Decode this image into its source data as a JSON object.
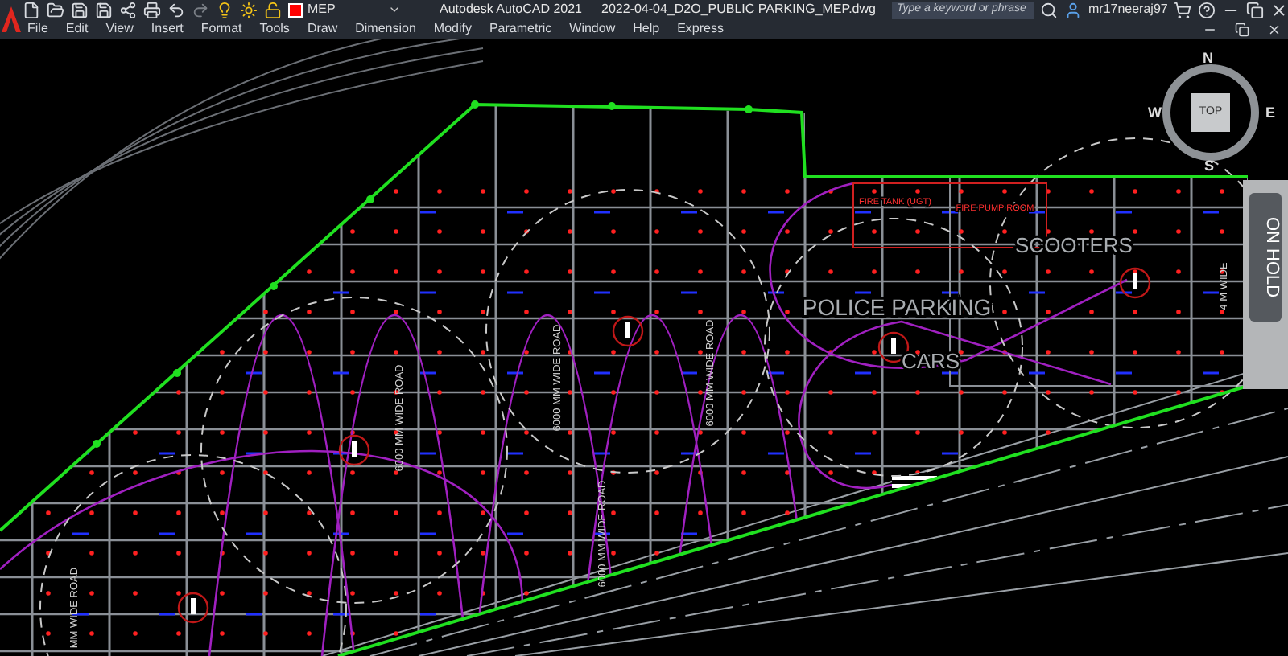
{
  "title_bar": {
    "layer": "MEP",
    "app_title": "Autodesk AutoCAD 2021",
    "file_name": "2022-04-04_D2O_PUBLIC PARKING_MEP.dwg",
    "search": {
      "placeholder": "Type a keyword or phrase"
    },
    "user": "mr17neeraj97"
  },
  "menu": [
    "File",
    "Edit",
    "View",
    "Insert",
    "Format",
    "Tools",
    "Draw",
    "Dimension",
    "Modify",
    "Parametric",
    "Window",
    "Help",
    "Express"
  ],
  "viewcube": {
    "face": "TOP",
    "north": "N",
    "east": "E",
    "south": "S",
    "west": "W"
  },
  "drawing": {
    "labels": [
      {
        "kind": "room",
        "text": "FIRE TANK (UGT)"
      },
      {
        "kind": "room",
        "text": "FIRE PUMP ROOM"
      },
      {
        "kind": "area",
        "text": "SCOOTERS"
      },
      {
        "kind": "area",
        "text": "POLICE PARKING"
      },
      {
        "kind": "area",
        "text": "CARS"
      },
      {
        "kind": "road",
        "text": "6000 MM WIDE ROAD"
      },
      {
        "kind": "road",
        "text": "6000 MM WIDE ROAD"
      },
      {
        "kind": "road",
        "text": "6000 MM WIDE ROAD"
      },
      {
        "kind": "road",
        "text": "6000 MM WIDE ROAD"
      },
      {
        "kind": "road",
        "text": "MM WIDE ROAD"
      },
      {
        "kind": "road",
        "text": "4 M WIDE"
      },
      {
        "kind": "hold",
        "text": "ON HOLD"
      }
    ]
  }
}
